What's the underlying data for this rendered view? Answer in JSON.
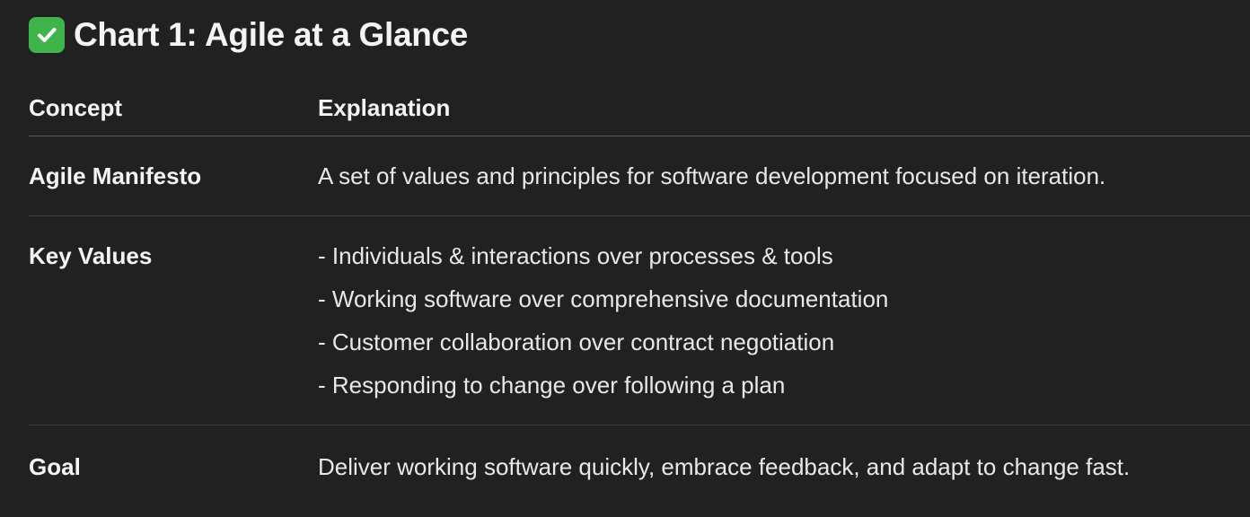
{
  "heading": {
    "icon": "check-mark-button-icon",
    "icon_color": "#3fb44a",
    "title": "Chart 1: Agile at a Glance"
  },
  "table": {
    "columns": [
      "Concept",
      "Explanation"
    ],
    "rows": [
      {
        "concept": "Agile Manifesto",
        "explanation": [
          "A set of values and principles for software development focused on iteration."
        ]
      },
      {
        "concept": "Key Values",
        "explanation": [
          "- Individuals & interactions over processes & tools",
          "- Working software over comprehensive documentation",
          "- Customer collaboration over contract negotiation",
          "- Responding to change over following a plan"
        ]
      },
      {
        "concept": "Goal",
        "explanation": [
          "Deliver working software quickly, embrace feedback, and adapt to change fast."
        ]
      }
    ]
  },
  "colors": {
    "background": "#212121",
    "text": "#ececec",
    "divider": "#3e3e3e"
  }
}
